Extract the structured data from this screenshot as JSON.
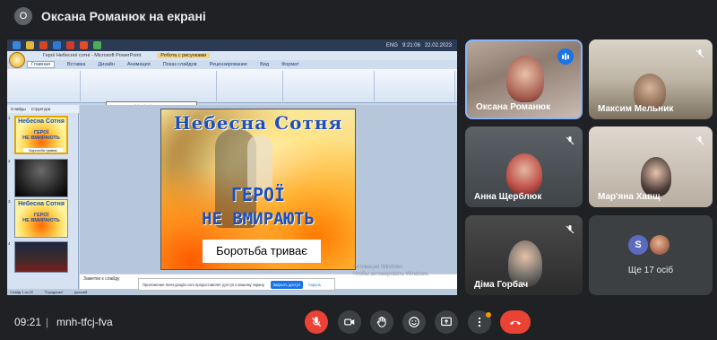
{
  "meet": {
    "presenter_initial": "О",
    "presenting_title": "Оксана Романюк на екрані",
    "time": "09:21",
    "meeting_code": "mnh-tfcj-fva",
    "others_count": "Ще 17 осіб",
    "others_avatar_initial": "S",
    "accent_color": "#8ab4f8",
    "danger_color": "#ea4335"
  },
  "participants": [
    {
      "name": "Оксана Романюк",
      "speaking": true
    },
    {
      "name": "Максим Мельник",
      "muted": true
    },
    {
      "name": "Анна Щерблюк",
      "muted": true
    },
    {
      "name": "Мар'яна Хавщ",
      "muted": true
    },
    {
      "name": "Діма Горбач",
      "muted": true
    }
  ],
  "screen_share": {
    "window_title": "Герої Небесної сотні - Microsoft PowerPoint",
    "context_tab": "Робота с рисунками",
    "tray_lang": "ENG",
    "tray_time": "9:21:06",
    "tray_date": "22.02.2023",
    "ribbon_tabs": [
      "Главная",
      "Вставка",
      "Дизайн",
      "Анимация",
      "Показ слайдов",
      "Рецензирование",
      "Вид",
      "Формат"
    ],
    "tooltip_title": "Подчеркнутый (Ctrl+U)",
    "tooltip_body": "Подчеркивание выделенного текста.",
    "pane_tabs": [
      "Слайды",
      "Структура"
    ],
    "slide_numbers": [
      "1",
      "2",
      "3",
      "4"
    ],
    "slide_title": "Небесна Сотня",
    "slide_heroes": "ГЕРОЇ",
    "slide_never": "НЕ ВМИРАЮТЬ",
    "slide_continues": "Боротьба триває",
    "notes_placeholder": "Заметки к слайду",
    "status_slide": "Слайд 1 из 22",
    "status_theme": "\"Городская\"",
    "status_lang": "русский",
    "infobar_text": "Приложение meet.google.com предоставляет доступ к вашему экрану.",
    "infobar_stop": "Закрыть доступ",
    "infobar_hide": "Скрыть",
    "watermark_line1": "Активация Windows",
    "watermark_line2": "Чтобы активировать Windows,"
  },
  "icons": {
    "mic_off": "mic-off-icon",
    "camera": "camera-icon",
    "raise_hand": "raise-hand-icon",
    "emoji": "emoji-icon",
    "present": "present-icon",
    "more": "more-vert-icon",
    "hangup": "hangup-icon"
  }
}
